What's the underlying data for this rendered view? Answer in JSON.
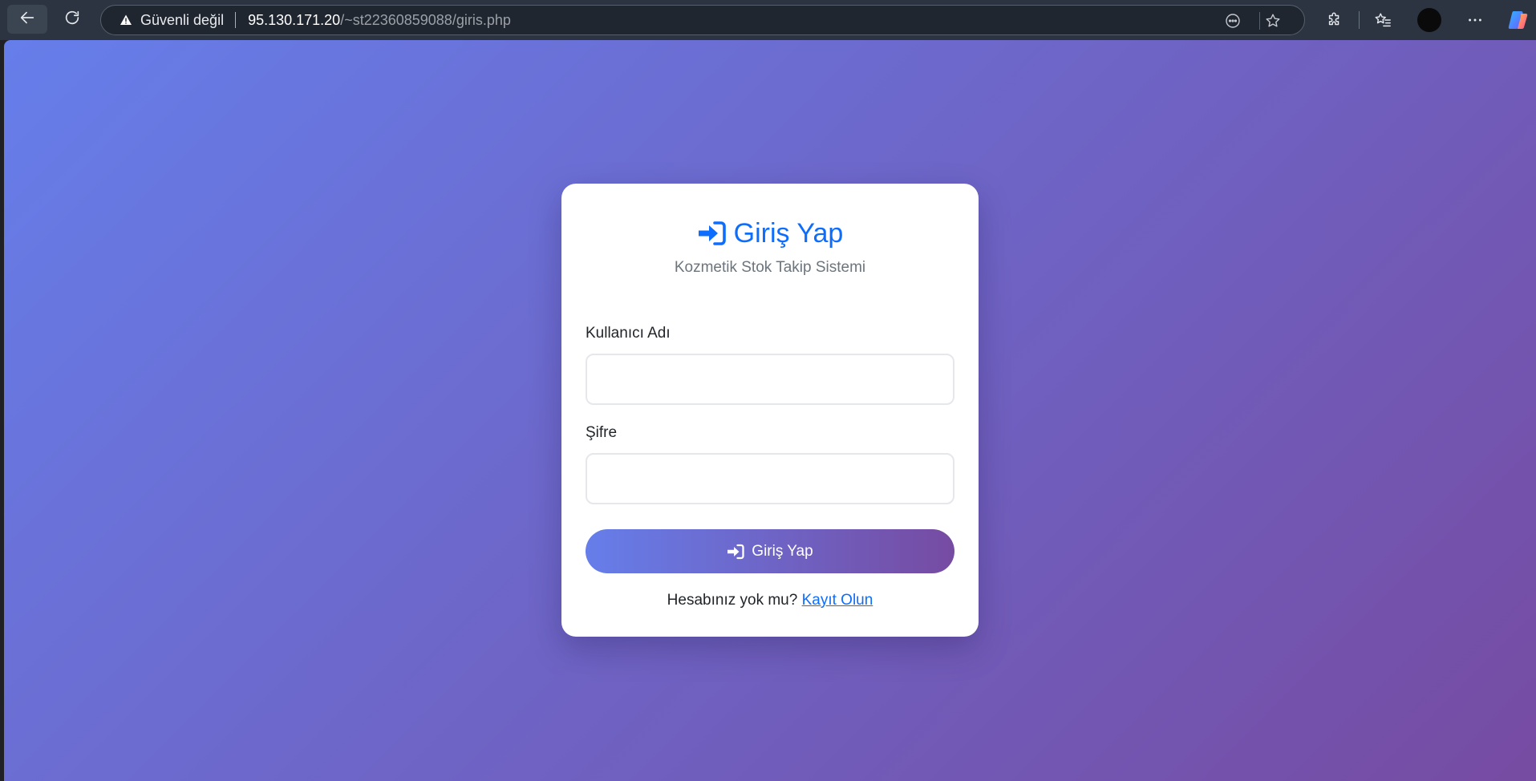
{
  "browser": {
    "security_label": "Güvenli değil",
    "url_host": "95.130.171.20",
    "url_path": "/~st22360859088/giris.php",
    "icons": {
      "back": "back-arrow-icon",
      "reload": "reload-icon",
      "security": "warning-triangle-icon",
      "reader": "reader-mode-icon",
      "favorite": "star-icon",
      "extensions": "puzzle-icon",
      "favorites": "favorites-icon",
      "more": "more-dots-icon",
      "copilot": "copilot-icon"
    }
  },
  "login": {
    "title": "Giriş Yap",
    "subtitle": "Kozmetik Stok Takip Sistemi",
    "username_label": "Kullanıcı Adı",
    "username_value": "",
    "password_label": "Şifre",
    "password_value": "",
    "submit_label": "Giriş Yap",
    "register_prompt": "Hesabınız yok mu?",
    "register_link": "Kayıt Olun",
    "title_icon": "sign-in-icon"
  },
  "colors": {
    "gradient_start": "#667eea",
    "gradient_end": "#764ba2",
    "accent": "#0d6efd",
    "card_bg": "#ffffff",
    "chrome_bg": "#2b3440"
  }
}
